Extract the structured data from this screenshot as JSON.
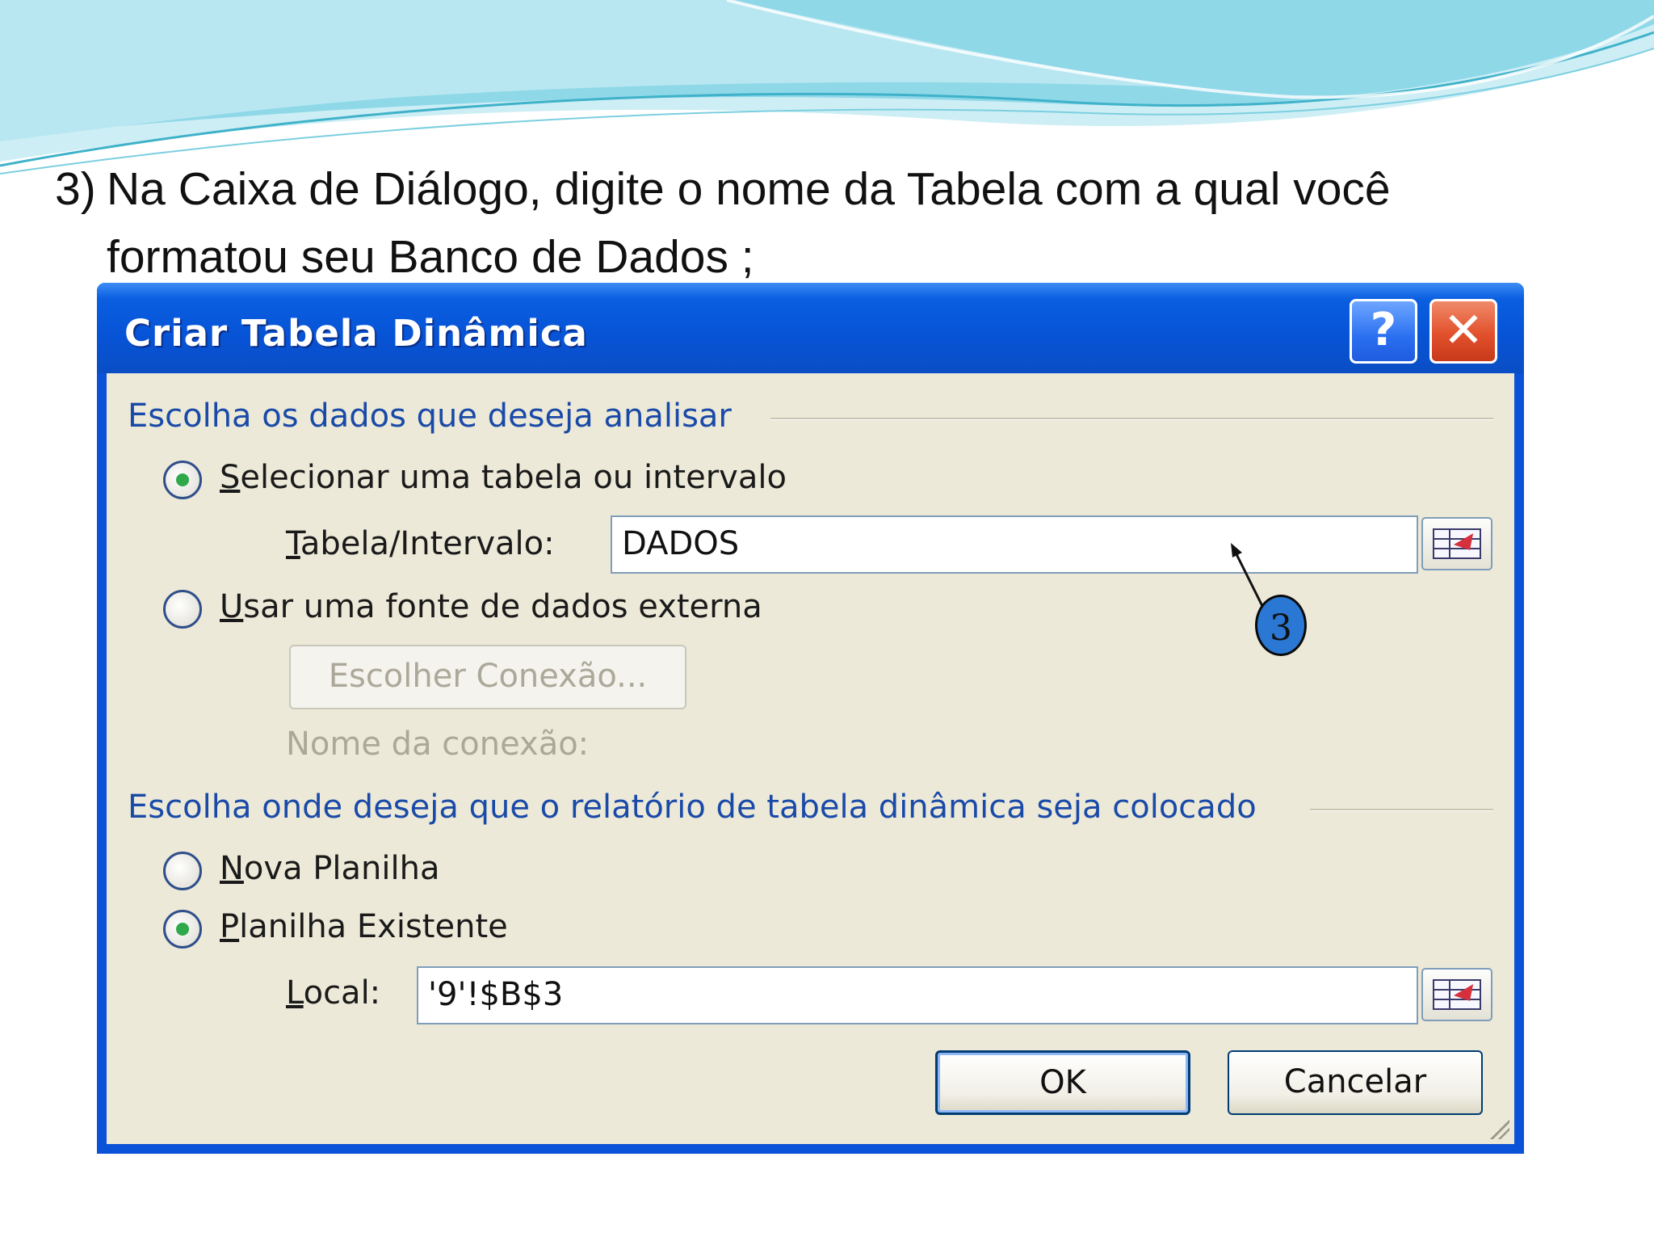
{
  "slide": {
    "step_number": "3)",
    "instruction": "Na Caixa de Diálogo, digite o nome da Tabela com a qual você formatou seu Banco de Dados ;"
  },
  "dialog": {
    "title": "Criar Tabela Dinâmica",
    "help_label": "?",
    "close_label": "✕",
    "section1_label": "Escolha os dados que deseja analisar",
    "option_select_table": {
      "first": "S",
      "rest": "elecionar uma tabela ou intervalo",
      "checked": true
    },
    "table_range_label": {
      "first": "T",
      "rest": "abela/Intervalo:"
    },
    "table_range_value": "DADOS",
    "option_external": {
      "first": "U",
      "rest": "sar uma fonte de dados externa",
      "checked": false
    },
    "choose_connection_label": "Escolher Conexão...",
    "connection_name_label": "Nome da conexão:",
    "section2_label": "Escolha onde deseja que o relatório de tabela dinâmica seja colocado",
    "option_new_sheet": {
      "first": "N",
      "rest": "ova Planilha",
      "checked": false
    },
    "option_existing_sheet": {
      "first": "P",
      "rest": "lanilha Existente",
      "checked": true
    },
    "location_label": {
      "first": "L",
      "rest": "ocal:"
    },
    "location_value": "'9'!$B$3",
    "ok_label": "OK",
    "cancel_label": "Cancelar"
  },
  "annotation": {
    "badge_text": "3",
    "badge_color": "#2a78d4"
  },
  "colors": {
    "titlebar": "#0753d6",
    "dialog_face": "#ece9d8",
    "section_label": "#1a4aa8",
    "wave_light": "#bfeaf3",
    "wave_mid": "#5fc4d8"
  },
  "icons": [
    "help-icon",
    "close-icon",
    "range-picker-icon",
    "resize-grip-icon"
  ]
}
